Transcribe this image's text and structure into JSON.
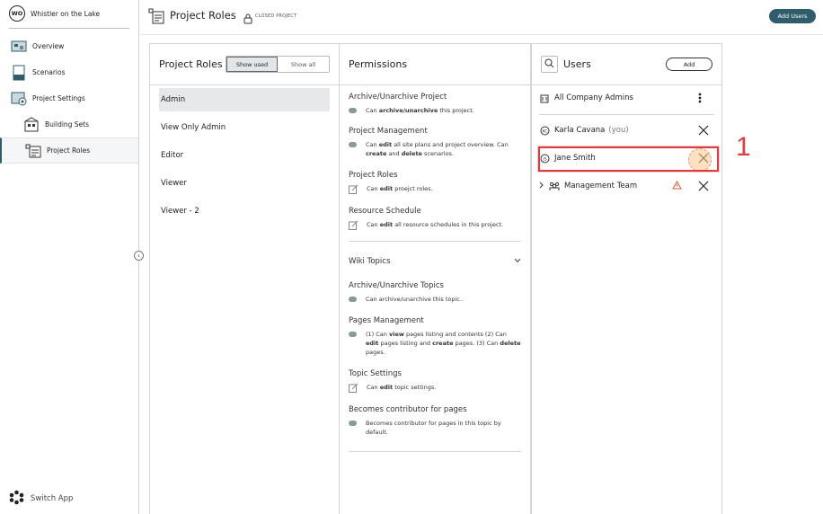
{
  "sidebar": {
    "project_badge": "WO",
    "project_name": "Whistler on the Lake",
    "items": [
      {
        "label": "Overview"
      },
      {
        "label": "Scenarios"
      },
      {
        "label": "Project Settings"
      },
      {
        "label": "Building Sets"
      },
      {
        "label": "Project Roles"
      }
    ],
    "switch_app": "Switch App"
  },
  "header": {
    "title": "Project Roles",
    "status": "CLOSED PROJECT",
    "add_users": "Add Users"
  },
  "roles_panel": {
    "title": "Project Roles",
    "filter_used": "Show used",
    "filter_all": "Show all",
    "roles": [
      "Admin",
      "View Only Admin",
      "Editor",
      "Viewer",
      "Viewer - 2"
    ],
    "selected": "Admin"
  },
  "permissions_panel": {
    "title": "Permissions",
    "items": [
      {
        "title": "Archive/Unarchive Project",
        "pre": "Can ",
        "bold": "archive/unarchive",
        "post": " this project."
      },
      {
        "title": "Project Management",
        "html": "Can <b>edit</b> all site plans and project overview. Can <b>create</b> and <b>delete</b> scenarios."
      },
      {
        "title": "Project Roles",
        "pre": "Can ",
        "bold": "edit",
        "post": " proejct roles."
      },
      {
        "title": "Resource Schedule",
        "pre": "Can ",
        "bold": "edit",
        "post": " all resource schedules in this project."
      }
    ],
    "wiki_section": "Wiki Topics",
    "wiki_items": [
      {
        "title": "Archive/Unarchive Topics",
        "text": "Can archive/unarchive this topic.."
      },
      {
        "title": "Pages Management",
        "html": "(1) Can <b>view</b> pages listing and contents (2) Can <b>edit</b> pages listing and <b>create</b> pages. (3) Can <b>delete</b> pages."
      },
      {
        "title": "Topic Settings",
        "pre": "Can ",
        "bold": "edit",
        "post": " topic settings."
      },
      {
        "title": "Becomes contributor for pages",
        "text": "Becomes contributor for pages in this topic by default."
      }
    ]
  },
  "users_panel": {
    "title": "Users",
    "add": "Add",
    "rows": [
      {
        "name": "All Company Admins"
      },
      {
        "name": "Karla Cavana",
        "suffix": "(you)"
      },
      {
        "name": "Jane Smith"
      },
      {
        "name": "Management Team"
      }
    ]
  },
  "annotation": {
    "step": "1"
  },
  "colors": {
    "accent": "#2f5d6b",
    "highlight": "#e03a3a",
    "warning": "#e05a3a"
  }
}
